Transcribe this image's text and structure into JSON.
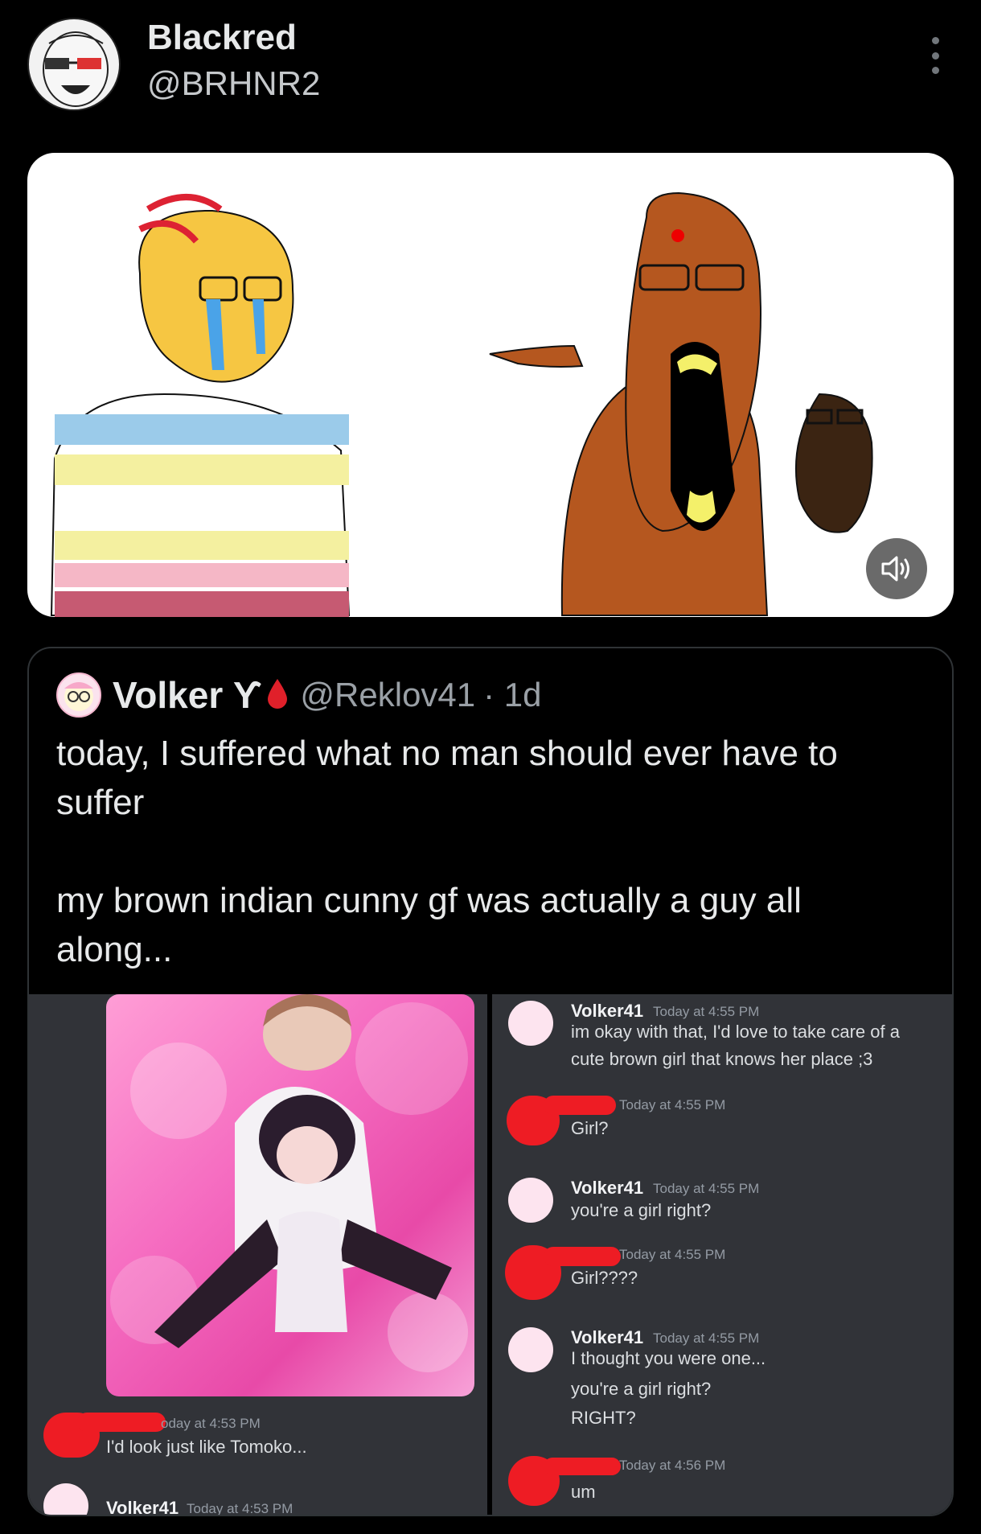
{
  "tweet": {
    "display_name": "Blackred",
    "handle": "@BRHNR2"
  },
  "quoted": {
    "display_name": "Volker ϒ",
    "handle": "@Reklov41",
    "age": "· 1d",
    "text": "today, I suffered what no man should ever have to suffer\n\nmy brown indian cunny gf was actually a guy all along..."
  },
  "discord": {
    "left": {
      "redacted_time": "oday at 4:53 PM",
      "redacted_text": "I'd look just like Tomoko...",
      "volker_name": "Volker41",
      "volker_time": "Today at 4:53 PM"
    },
    "right": [
      {
        "author": "Volker41",
        "time": "Today at 4:55 PM",
        "lines": [
          "im okay with that, I'd love to take care of a",
          "cute brown girl that knows her place ;3"
        ]
      },
      {
        "author": "",
        "time": "Today at 4:55 PM",
        "lines": [
          "Girl?"
        ]
      },
      {
        "author": "Volker41",
        "time": "Today at 4:55 PM",
        "lines": [
          "you're a girl right?"
        ]
      },
      {
        "author": "",
        "time": "Today at 4:55 PM",
        "lines": [
          "Girl????"
        ]
      },
      {
        "author": "Volker41",
        "time": "Today at 4:55 PM",
        "lines": [
          "I thought you were one...",
          "you're a girl right?",
          "RIGHT?"
        ]
      },
      {
        "author": "",
        "time": "Today at 4:56 PM",
        "lines": [
          "um"
        ]
      }
    ]
  },
  "colors": {
    "background": "#000000",
    "text_primary": "#e7e9ea",
    "text_secondary": "#71767b",
    "discord_bg": "#313338",
    "redaction": "#ee1c24"
  },
  "icons": {
    "more": "more-vertical-icon",
    "sound": "speaker-icon",
    "drop": "blood-drop-icon"
  }
}
